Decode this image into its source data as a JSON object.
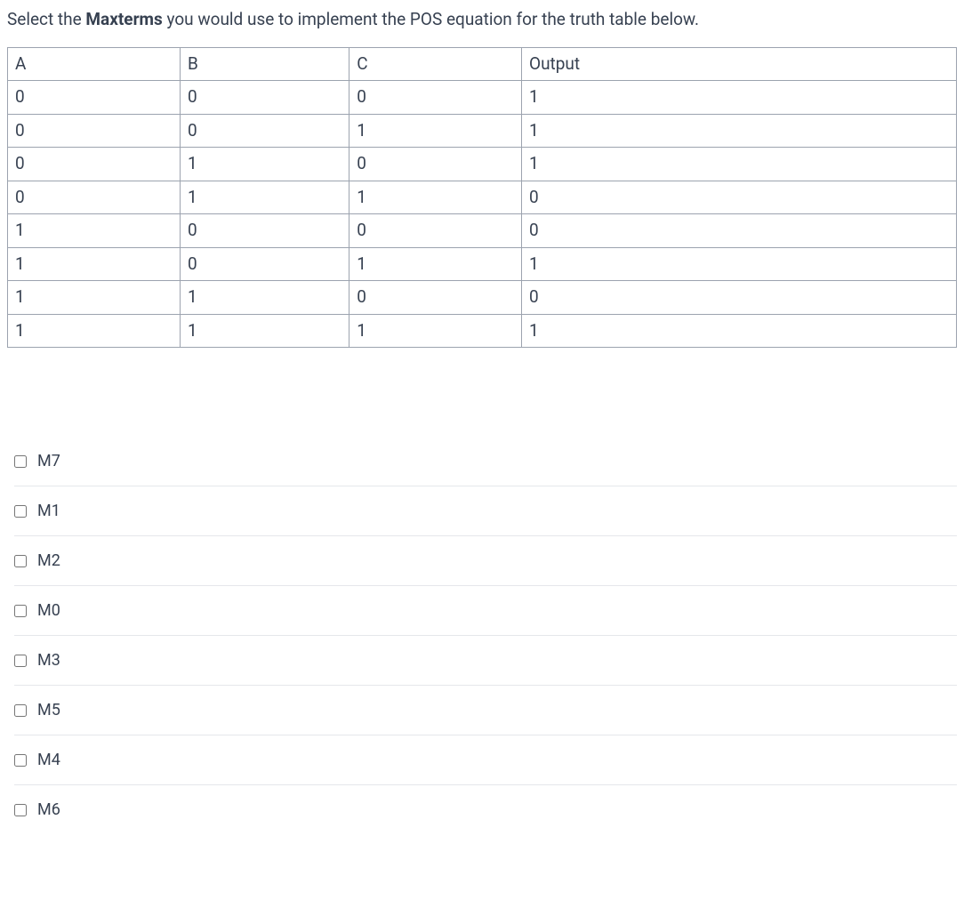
{
  "question": {
    "prefix": "Select the ",
    "bold": "Maxterms",
    "suffix": " you would use to implement the POS equation for the truth table below."
  },
  "table": {
    "headers": [
      "A",
      "B",
      "C",
      "Output"
    ],
    "rows": [
      [
        "0",
        "0",
        "0",
        "1"
      ],
      [
        "0",
        "0",
        "1",
        "1"
      ],
      [
        "0",
        "1",
        "0",
        "1"
      ],
      [
        "0",
        "1",
        "1",
        "0"
      ],
      [
        "1",
        "0",
        "0",
        "0"
      ],
      [
        "1",
        "0",
        "1",
        "1"
      ],
      [
        "1",
        "1",
        "0",
        "0"
      ],
      [
        "1",
        "1",
        "1",
        "1"
      ]
    ]
  },
  "options": [
    {
      "label": "M7"
    },
    {
      "label": "M1"
    },
    {
      "label": "M2"
    },
    {
      "label": "M0"
    },
    {
      "label": "M3"
    },
    {
      "label": "M5"
    },
    {
      "label": "M4"
    },
    {
      "label": "M6"
    }
  ]
}
